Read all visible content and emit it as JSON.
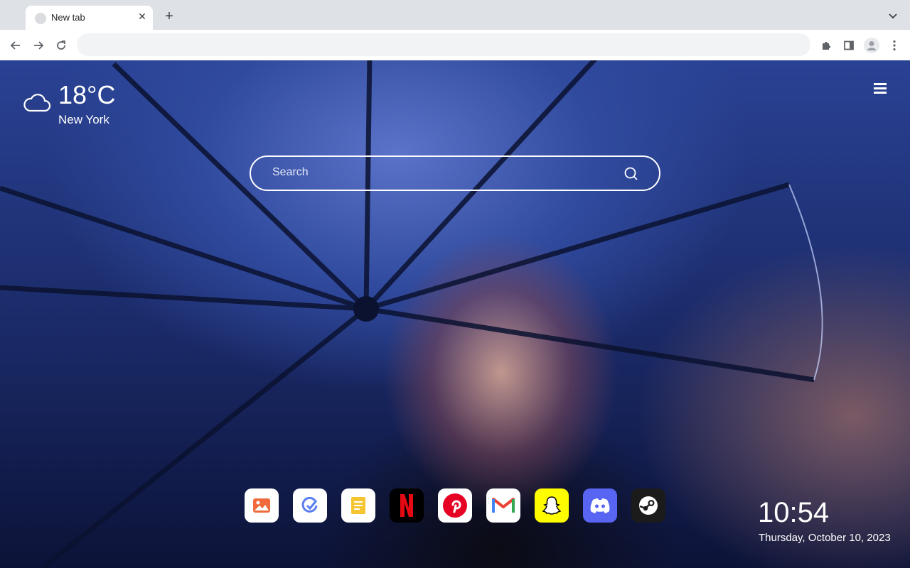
{
  "browser": {
    "tab_title": "New tab",
    "omnibox_value": ""
  },
  "weather": {
    "temperature": "18°C",
    "city": "New York",
    "icon": "cloud-icon"
  },
  "search": {
    "placeholder": "Search"
  },
  "dock": {
    "apps": [
      {
        "name": "Photos",
        "icon": "photos-icon",
        "color": "#ffffff"
      },
      {
        "name": "Task",
        "icon": "task-icon",
        "color": "#ffffff"
      },
      {
        "name": "Notes",
        "icon": "notes-icon",
        "color": "#ffffff"
      },
      {
        "name": "Netflix",
        "icon": "netflix-icon",
        "color": "#000000"
      },
      {
        "name": "Pinterest",
        "icon": "pinterest-icon",
        "color": "#ffffff"
      },
      {
        "name": "Gmail",
        "icon": "gmail-icon",
        "color": "#ffffff"
      },
      {
        "name": "Snapchat",
        "icon": "snapchat-icon",
        "color": "#fffc00"
      },
      {
        "name": "Discord",
        "icon": "discord-icon",
        "color": "#5865f2"
      },
      {
        "name": "Steam",
        "icon": "steam-icon",
        "color": "#1b1b1b"
      }
    ]
  },
  "clock": {
    "time": "10:54",
    "date": "Thursday, October 10, 2023"
  }
}
